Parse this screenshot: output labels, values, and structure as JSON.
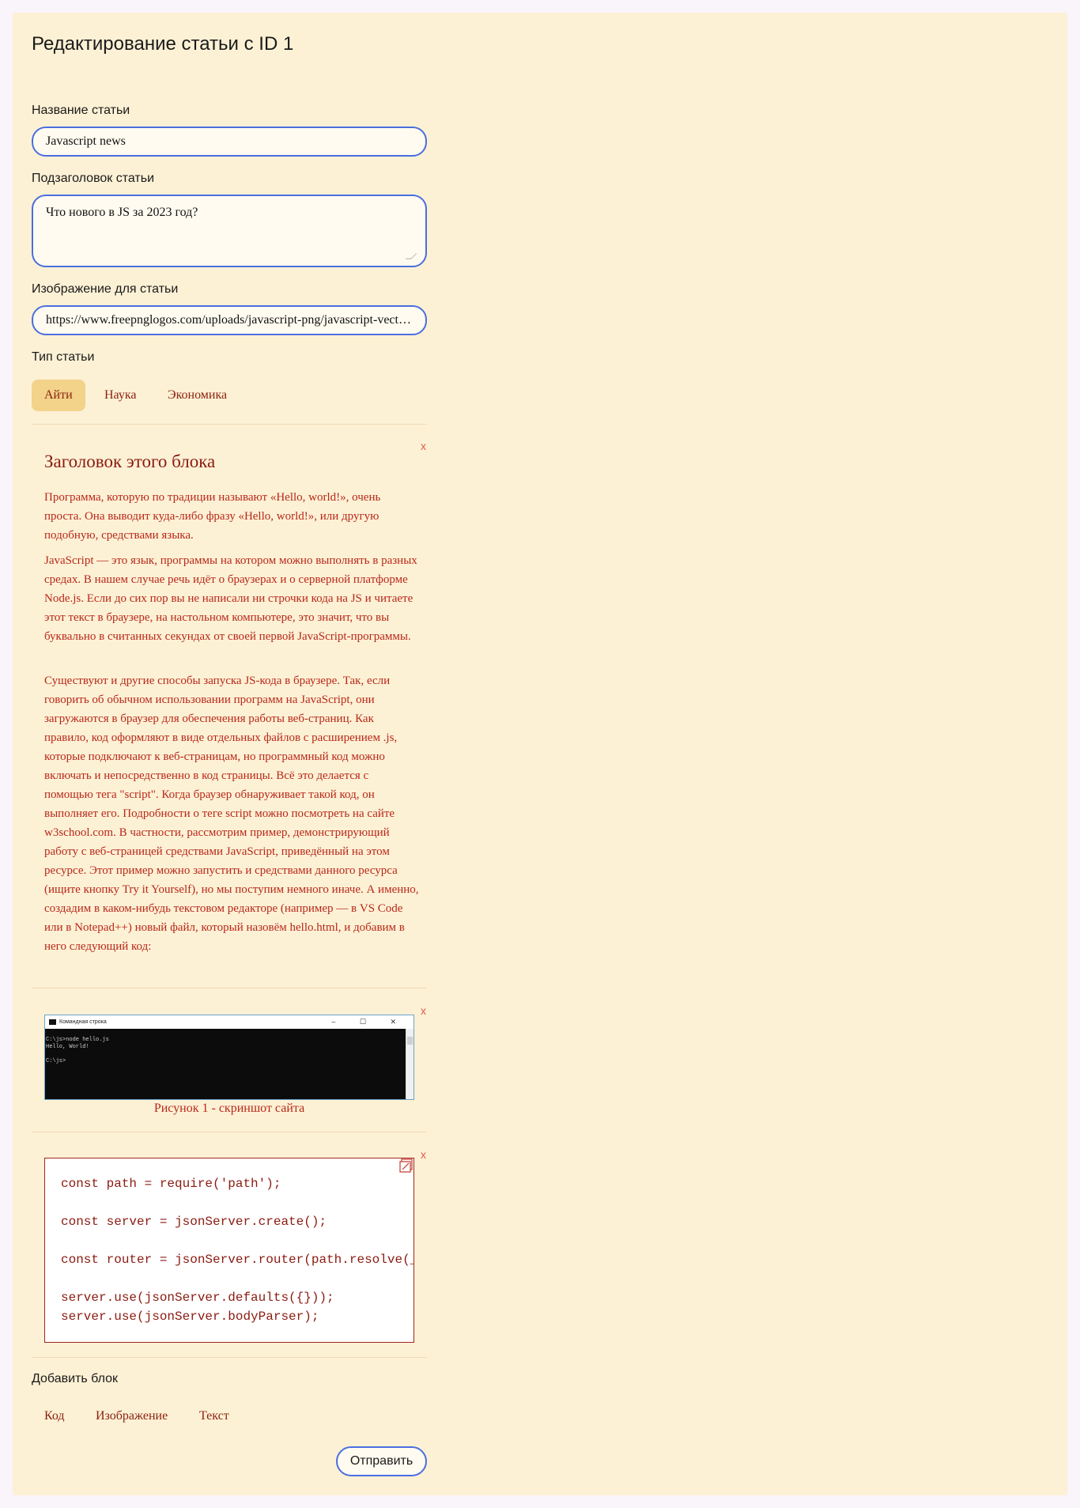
{
  "page": {
    "title": "Редактирование статьи с ID 1"
  },
  "form": {
    "title_label": "Название статьи",
    "title_value": "Javascript news",
    "subtitle_label": "Подзаголовок статьи",
    "subtitle_value": "Что нового в JS за 2023 год?",
    "image_label": "Изображение для статьи",
    "image_value": "https://www.freepnglogos.com/uploads/javascript-png/javascript-vector-logo-yellow-png-transparent-javascript-vector-12.png",
    "type_label": "Тип статьи",
    "types": [
      "Айти",
      "Наука",
      "Экономика"
    ],
    "active_type": "Айти"
  },
  "blocks": {
    "close_label": "x",
    "text_block": {
      "title": "Заголовок этого блока",
      "paragraphs": [
        "Программа, которую по традиции называют «Hello, world!», очень проста. Она выводит куда-либо фразу «Hello, world!», или другую подобную, средствами языка.",
        "JavaScript — это язык, программы на котором можно выполнять в разных средах. В нашем случае речь идёт о браузерах и о серверной платформе Node.js. Если до сих пор вы не написали ни строчки кода на JS и читаете этот текст в браузере, на настольном компьютере, это значит, что вы буквально в считанных секундах от своей первой JavaScript-программы.",
        "Существуют и другие способы запуска JS-кода в браузере. Так, если говорить об обычном использовании программ на JavaScript, они загружаются в браузер для обеспечения работы веб-страниц. Как правило, код оформляют в виде отдельных файлов с расширением .js, которые подключают к веб-страницам, но программный код можно включать и непосредственно в код страницы. Всё это делается с помощью тега \"script\". Когда браузер обнаруживает такой код, он выполняет его. Подробности о теге script можно посмотреть на сайте w3school.com. В частности, рассмотрим пример, демонстрирующий работу с веб-страницей средствами JavaScript, приведённый на этом ресурсе. Этот пример можно запустить и средствами данного ресурса (ищите кнопку Try it Yourself), но мы поступим немного иначе. А именно, создадим в каком-нибудь текстовом редакторе (например — в VS Code или в Notepad++) новый файл, который назовём hello.html, и добавим в него следующий код:"
      ]
    },
    "image_block": {
      "window_title": "Командная строка",
      "window_controls": "– ☐ ✕",
      "console_text": "C:\\js>node hello.js\nHello, World!\n\nC:\\js>",
      "caption": "Рисунок 1 - скриншот сайта"
    },
    "code_block": {
      "code": "const path = require('path');\n\nconst server = jsonServer.create();\n\nconst router = jsonServer.router(path.resolve(__dirname, 'db.json'));\n\nserver.use(jsonServer.defaults({}));\nserver.use(jsonServer.bodyParser);"
    }
  },
  "add_block": {
    "label": "Добавить блок",
    "options": [
      "Код",
      "Изображение",
      "Текст"
    ]
  },
  "submit_label": "Отправить"
}
